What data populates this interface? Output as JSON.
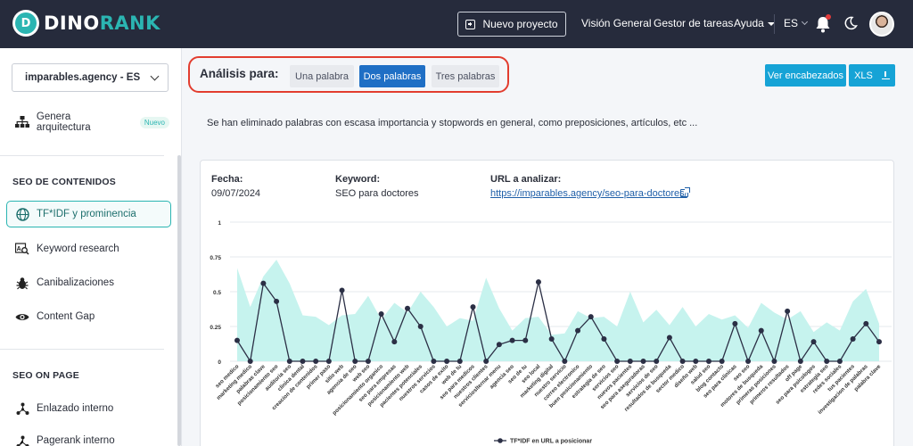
{
  "header": {
    "brand_part1": "DINO",
    "brand_part2": "RANK",
    "new_project_label": "Nuevo proyecto",
    "nav": [
      "Visión General",
      "Gestor de tareas",
      "Ayuda"
    ],
    "language": "ES",
    "accent_color": "#2bb5b2"
  },
  "sidebar": {
    "project": "imparables.agency - ES",
    "top_item": {
      "label": "Genera arquitectura",
      "badge": "Nuevo",
      "icon": "sitemap-icon"
    },
    "section1_title": "SEO DE CONTENIDOS",
    "section1_items": [
      {
        "label": "TF*IDF y prominencia",
        "icon": "globe-icon",
        "active": true
      },
      {
        "label": "Keyword research",
        "icon": "search-keyword-icon"
      },
      {
        "label": "Canibalizaciones",
        "icon": "bug-icon"
      },
      {
        "label": "Content Gap",
        "icon": "eye-icon"
      }
    ],
    "section2_title": "SEO ON PAGE",
    "section2_items": [
      {
        "label": "Enlazado interno",
        "icon": "link-tree-icon"
      },
      {
        "label": "Pagerank interno",
        "icon": "link-tree-icon"
      }
    ]
  },
  "analysis": {
    "label": "Análisis para:",
    "options": [
      "Una palabra",
      "Dos palabras",
      "Tres palabras"
    ],
    "selected": "Dos palabras",
    "headers_button": "Ver encabezados",
    "export_button": "XLS"
  },
  "notice": "Se han eliminado palabras con escasa importancia y stopwords en general, como preposiciones, artículos, etc ...",
  "report": {
    "date_label": "Fecha:",
    "date_value": "09/07/2024",
    "keyword_label": "Keyword:",
    "keyword_value": "SEO para doctores",
    "url_label": "URL a analizar:",
    "url_value": "https://imparables.agency/seo-para-doctores/"
  },
  "chart_data": {
    "type": "line",
    "ylim": [
      0,
      1
    ],
    "yticks": [
      "0",
      "0.25",
      "0.5",
      "0.75",
      "1"
    ],
    "grid": true,
    "legend_position": "bottom",
    "colors": {
      "line": "#2b2f45",
      "area": "#c6f3ee"
    },
    "categories": [
      "seo medico",
      "marketing medico",
      "palabras clave",
      "posicionamiento seo",
      "auditoria seo",
      "clinica dental",
      "creacion de contenidos",
      "primer paso",
      "sitio web",
      "agencia de seo",
      "web seo",
      "posicionamiento organico",
      "seo para empresas",
      "posicionamiento web",
      "pacientes potenciales",
      "nuestros servicios",
      "casos de exito",
      "web de tu",
      "seo para medicos",
      "nuestros clientes",
      "servicioslternar menu",
      "agencia seo",
      "seo de tu",
      "seo local",
      "marketing digital",
      "nuestro servicio",
      "correo electronico",
      "buen posicionamiento",
      "estrategia de seo",
      "servicios seo",
      "nuevos pacientes",
      "seo para aseguradoras",
      "servicios de seo",
      "resultados de busqueda",
      "sector medico",
      "diseño web",
      "salud seo",
      "blog contacto",
      "seo para clinicas",
      "seo seo",
      "motores de busqueda",
      "primeras posiciones",
      "primeros resultados",
      "off page",
      "seo para psicologos",
      "estrategia seo",
      "redes sociales",
      "tus pacientes",
      "investigacion de palabras",
      "palabra clave"
    ],
    "series": [
      {
        "name": "TF*IDF en URL a posicionar",
        "values": [
          0.15,
          0.0,
          0.56,
          0.43,
          0.0,
          0.0,
          0.0,
          0.0,
          0.51,
          0.0,
          0.0,
          0.34,
          0.14,
          0.38,
          0.25,
          0.0,
          0.0,
          0.0,
          0.39,
          0.0,
          0.12,
          0.15,
          0.15,
          0.57,
          0.16,
          0.0,
          0.22,
          0.32,
          0.16,
          0.0,
          0.0,
          0.0,
          0.0,
          0.17,
          0.0,
          0.0,
          0.0,
          0.0,
          0.27,
          0.0,
          0.22,
          0.0,
          0.36,
          0.0,
          0.14,
          0.0,
          0.0,
          0.16,
          0.27,
          0.14
        ]
      },
      {
        "values": [
          0.67,
          0.39,
          0.61,
          0.73,
          0.56,
          0.33,
          0.32,
          0.26,
          0.33,
          0.34,
          0.47,
          0.3,
          0.42,
          0.35,
          0.5,
          0.39,
          0.25,
          0.31,
          0.29,
          0.6,
          0.38,
          0.22,
          0.31,
          0.32,
          0.19,
          0.2,
          0.36,
          0.31,
          0.32,
          0.25,
          0.5,
          0.28,
          0.37,
          0.26,
          0.39,
          0.25,
          0.34,
          0.3,
          0.33,
          0.24,
          0.42,
          0.35,
          0.3,
          0.36,
          0.21,
          0.28,
          0.22,
          0.43,
          0.52,
          0.27
        ]
      }
    ]
  }
}
